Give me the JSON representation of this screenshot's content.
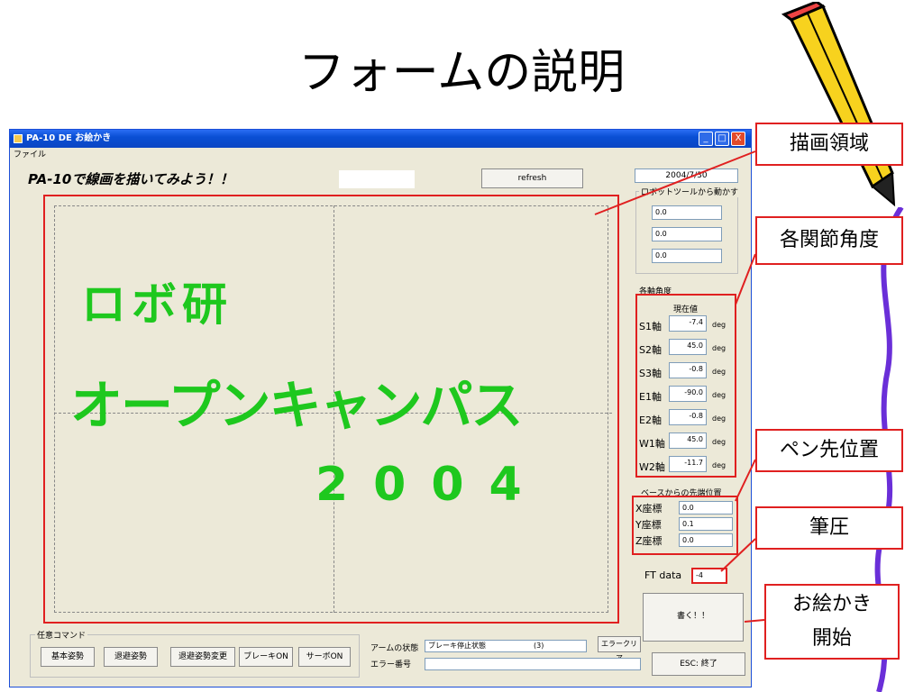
{
  "slide": {
    "title": "フォームの説明"
  },
  "window": {
    "title": "PA-10 DE お絵かき",
    "menu": "ファイル",
    "heading": "PA-10で線画を描いてみよう！！",
    "refresh_label": "refresh",
    "date_value": "2004/7/30",
    "tb_minimize": "_",
    "tb_maximize": "□",
    "tb_close": "X"
  },
  "canvas": {
    "line1": "ロボ研",
    "line2": "オープンキャンパス",
    "line3": "2004"
  },
  "tool_group": {
    "label": "ロボットツールから動かす",
    "values": [
      "0.0",
      "0.0",
      "0.0"
    ]
  },
  "joints": {
    "group_label": "各軸角度",
    "current_label": "現在値",
    "unit": "deg",
    "rows": [
      {
        "name": "S1軸",
        "value": "-7.4"
      },
      {
        "name": "S2軸",
        "value": "45.0"
      },
      {
        "name": "S3軸",
        "value": "-0.8"
      },
      {
        "name": "E1軸",
        "value": "-90.0"
      },
      {
        "name": "E2軸",
        "value": "-0.8"
      },
      {
        "name": "W1軸",
        "value": "45.0"
      },
      {
        "name": "W2軸",
        "value": "-11.7"
      }
    ]
  },
  "position": {
    "group_label": "ベースからの先端位置",
    "rows": [
      {
        "name": "X座標",
        "value": "0.0"
      },
      {
        "name": "Y座標",
        "value": "0.1"
      },
      {
        "name": "Z座標",
        "value": "0.0"
      }
    ]
  },
  "ft": {
    "label": "FT data",
    "value": "-4"
  },
  "draw_button": "書く！！",
  "esc_button": "ESC: 終了",
  "commands": {
    "group_label": "任意コマンド",
    "buttons": [
      "基本姿勢",
      "退避姿勢",
      "退避姿勢変更",
      "ブレーキON",
      "サーボON"
    ]
  },
  "arm_status": {
    "label": "アームの状態",
    "value": "ブレーキ停止状態",
    "code": "(3)",
    "clear_label": "エラークリア"
  },
  "error_no": {
    "label": "エラー番号",
    "value": ""
  },
  "callouts": {
    "draw_area": "描画領域",
    "joint_angles": "各関節角度",
    "pen_position": "ペン先位置",
    "pen_pressure": "筆圧",
    "start_drawing": "お絵かき\n開始"
  }
}
